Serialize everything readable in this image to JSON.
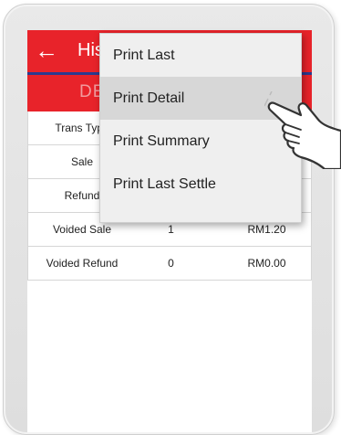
{
  "header": {
    "title": "History",
    "subtitle": "DETAIL"
  },
  "table": {
    "rows": [
      {
        "type": "Trans Type",
        "count": "",
        "amount": ""
      },
      {
        "type": "Sale",
        "count": "",
        "amount": ""
      },
      {
        "type": "Refund",
        "count": "",
        "amount": ""
      },
      {
        "type": "Voided Sale",
        "count": "1",
        "amount": "RM1.20"
      },
      {
        "type": "Voided Refund",
        "count": "0",
        "amount": "RM0.00"
      }
    ]
  },
  "menu": {
    "items": [
      {
        "label": "Print Last"
      },
      {
        "label": "Print Detail"
      },
      {
        "label": "Print Summary"
      },
      {
        "label": "Print Last Settle"
      }
    ],
    "highlighted_index": 1
  },
  "colors": {
    "appbar": "#e8232a",
    "accent_line": "#2b3a8f",
    "menu_bg": "#efefef",
    "menu_highlight": "#d7d7d7"
  },
  "icons": {
    "back": "back-arrow-icon",
    "pointer": "tapping-hand-icon"
  }
}
